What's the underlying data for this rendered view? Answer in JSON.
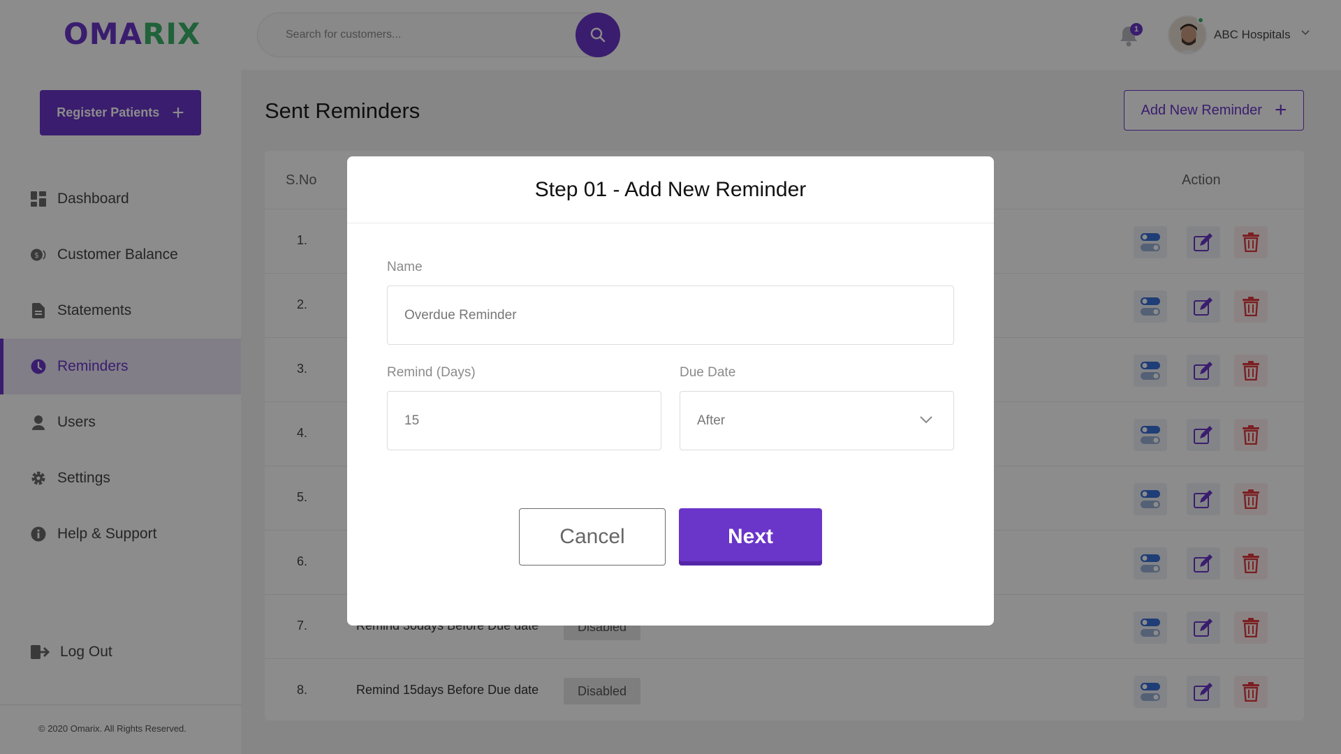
{
  "brand": {
    "logo_part1": "OMA",
    "logo_part2": "RIX"
  },
  "sidebar": {
    "register_label": "Register Patients",
    "items": [
      {
        "label": "Dashboard",
        "icon": "dashboard-icon"
      },
      {
        "label": "Customer Balance",
        "icon": "balance-icon"
      },
      {
        "label": "Statements",
        "icon": "document-icon"
      },
      {
        "label": "Reminders",
        "icon": "clock-icon",
        "active": true
      },
      {
        "label": "Users",
        "icon": "user-icon"
      },
      {
        "label": "Settings",
        "icon": "gear-icon"
      },
      {
        "label": "Help & Support",
        "icon": "info-icon"
      }
    ],
    "logout_label": "Log Out",
    "copyright": "© 2020 Omarix. All Rights Reserved."
  },
  "topbar": {
    "search_placeholder": "Search for customers...",
    "notification_count": "1",
    "account_name": "ABC Hospitals"
  },
  "main": {
    "title": "Sent Reminders",
    "add_button_label": "Add New Reminder",
    "table": {
      "headers": {
        "sno": "S.No",
        "action": "Action"
      },
      "rows": [
        {
          "sno": "1.",
          "name": "",
          "status": ""
        },
        {
          "sno": "2.",
          "name": "",
          "status": ""
        },
        {
          "sno": "3.",
          "name": "",
          "status": ""
        },
        {
          "sno": "4.",
          "name": "",
          "status": ""
        },
        {
          "sno": "5.",
          "name": "",
          "status": ""
        },
        {
          "sno": "6.",
          "name": "",
          "status": ""
        },
        {
          "sno": "7.",
          "name": "Remind 30days Before Due date",
          "status": "Disabled"
        },
        {
          "sno": "8.",
          "name": "Remind 15days Before Due date",
          "status": "Disabled"
        }
      ]
    }
  },
  "modal": {
    "title": "Step 01 - Add New Reminder",
    "name_label": "Name",
    "name_value": "Overdue Reminder",
    "remind_label": "Remind (Days)",
    "remind_value": "15",
    "due_label": "Due Date",
    "due_value": "After",
    "cancel_label": "Cancel",
    "next_label": "Next"
  },
  "colors": {
    "accent": "#6a35c9",
    "brand_green": "#3bb36b",
    "delete_red": "#e0393e",
    "toggle_blue": "#3a6fd8"
  }
}
